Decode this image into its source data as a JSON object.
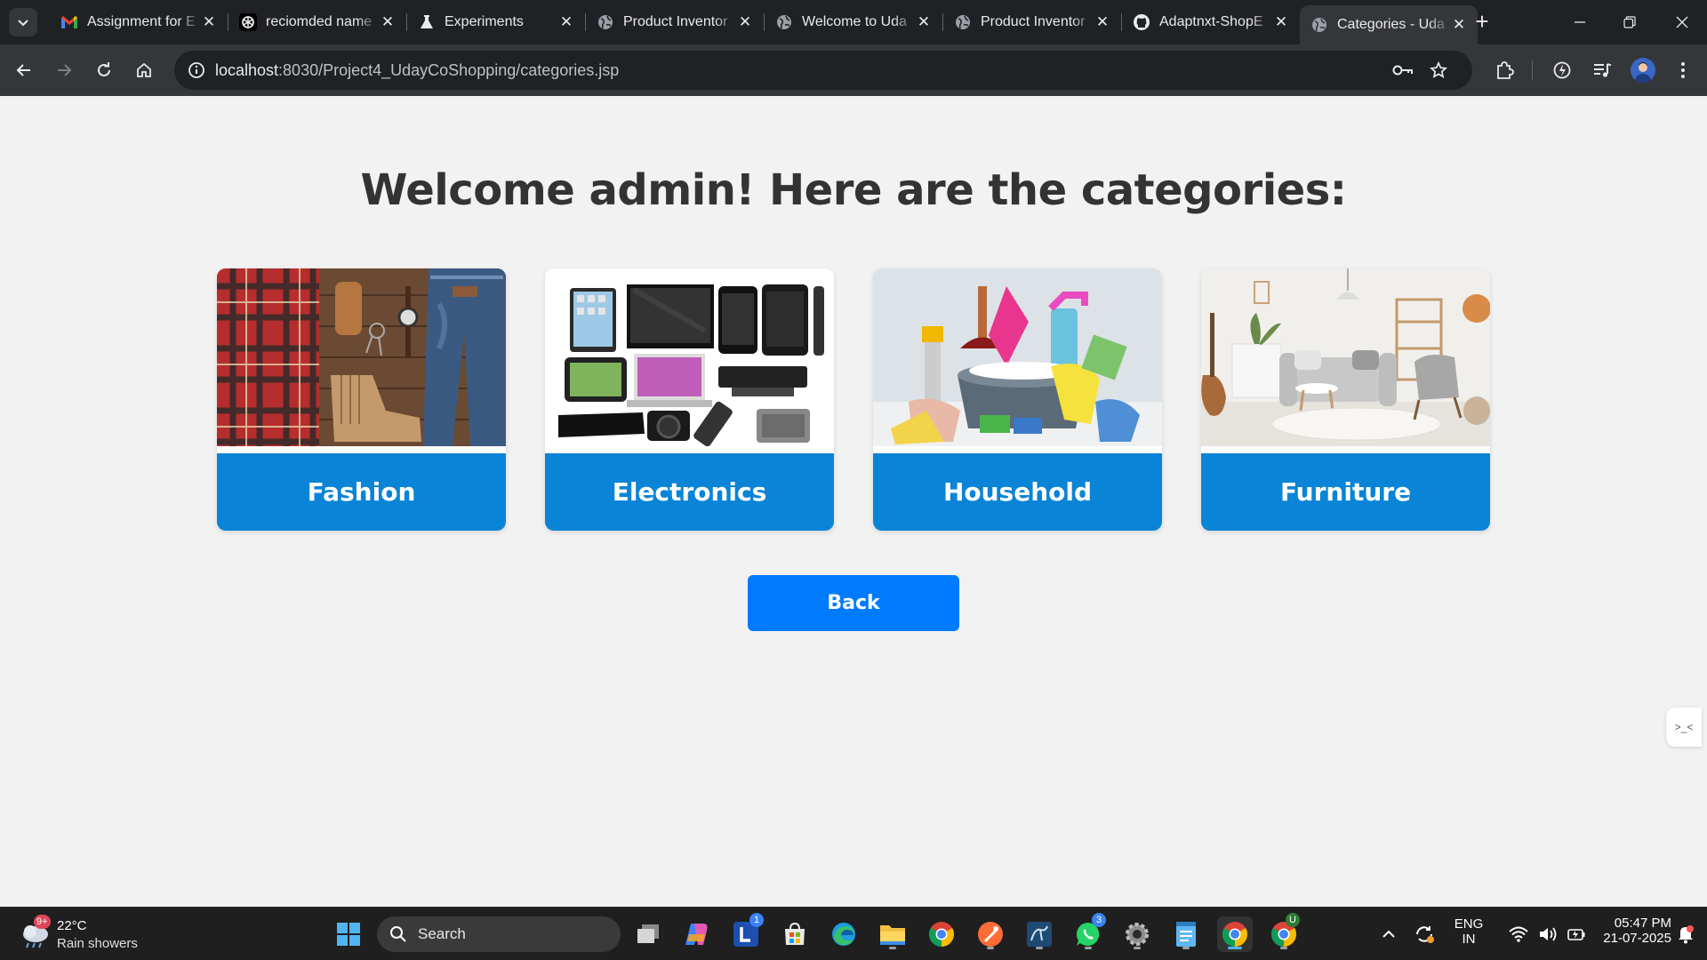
{
  "browser": {
    "tabs": [
      {
        "title": "Assignment for E",
        "icon": "gmail-icon",
        "active": false
      },
      {
        "title": "reciomded name",
        "icon": "openai-icon",
        "active": false
      },
      {
        "title": "Experiments",
        "icon": "flask-icon",
        "active": false
      },
      {
        "title": "Product Inventor",
        "icon": "globe-icon",
        "active": false
      },
      {
        "title": "Welcome to Uda",
        "icon": "globe-icon",
        "active": false
      },
      {
        "title": "Product Inventor",
        "icon": "globe-icon",
        "active": false
      },
      {
        "title": "Adaptnxt-ShopE",
        "icon": "github-icon",
        "active": false
      },
      {
        "title": "Categories - Uda",
        "icon": "globe-icon",
        "active": true
      }
    ],
    "url_host": "localhost",
    "url_rest": ":8030/Project4_UdayCoShopping/categories.jsp"
  },
  "page": {
    "heading": "Welcome admin! Here are the categories:",
    "categories": [
      {
        "label": "Fashion",
        "image": "fashion-photo"
      },
      {
        "label": "Electronics",
        "image": "electronics-photo"
      },
      {
        "label": "Household",
        "image": "household-photo"
      },
      {
        "label": "Furniture",
        "image": "furniture-photo"
      }
    ],
    "back_label": "Back",
    "side_widget_glyph": ">_<"
  },
  "taskbar": {
    "weather_temp": "22°C",
    "weather_desc": "Rain showers",
    "weather_badge": "9+",
    "search_label": "Search",
    "lang_top": "ENG",
    "lang_bottom": "IN",
    "time": "05:47 PM",
    "date": "21-07-2025",
    "badges": {
      "l_app": "1",
      "whatsapp": "3",
      "chrome_profile": "U"
    }
  },
  "colors": {
    "accent_blue": "#007bff",
    "card_label_blue": "#0a84d6",
    "heading_text": "#333333",
    "page_bg": "#f2f2f2"
  }
}
